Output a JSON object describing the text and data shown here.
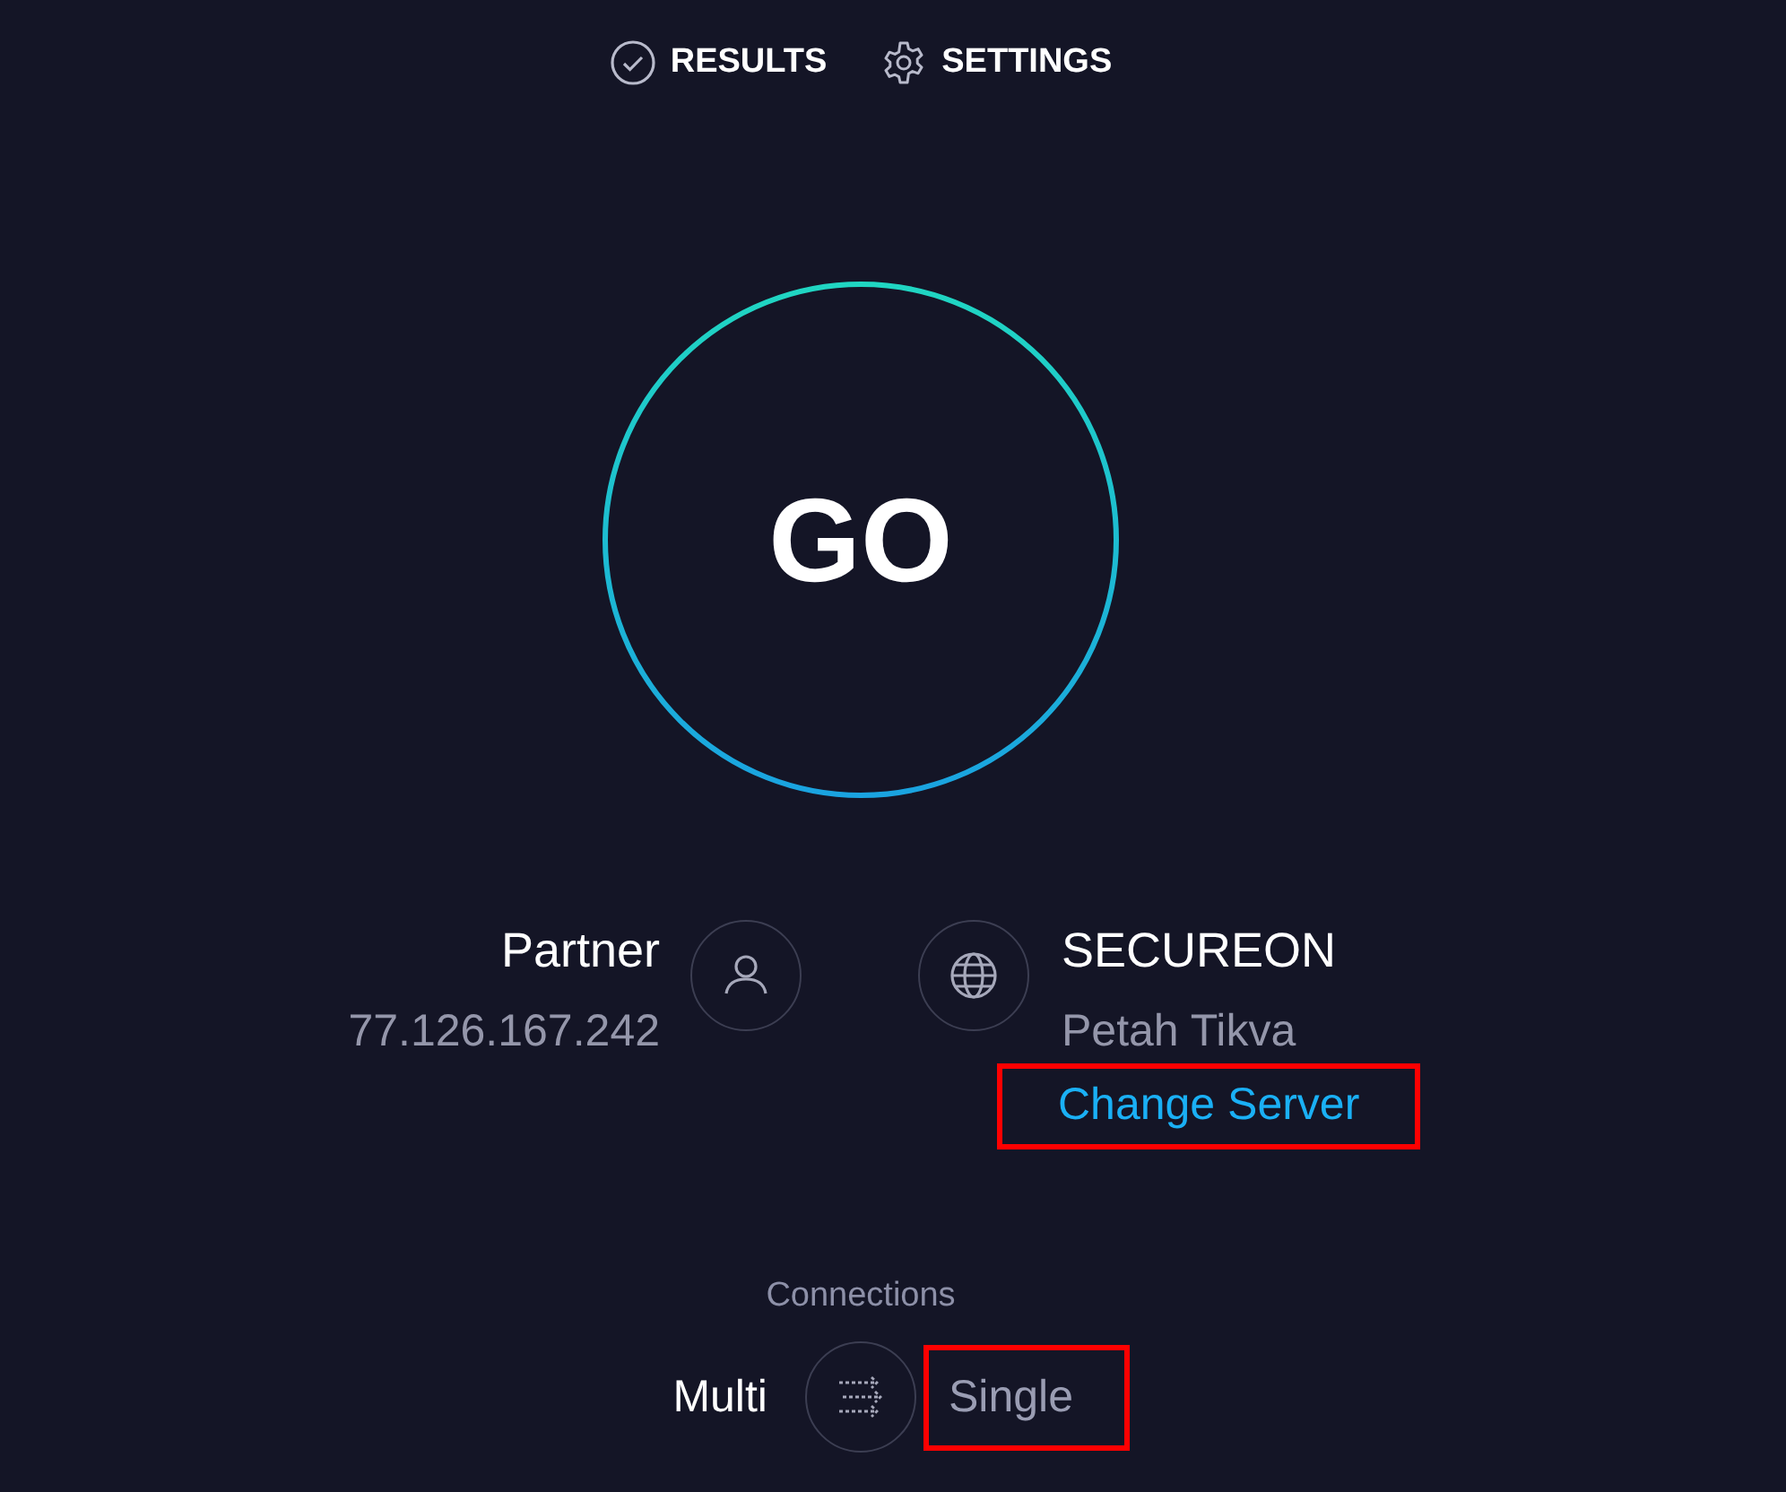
{
  "nav": [
    {
      "label": "RESULTS"
    },
    {
      "label": "SETTINGS"
    }
  ],
  "go_button": {
    "label": "GO"
  },
  "isp": {
    "name": "Partner",
    "ip": "77.126.167.242"
  },
  "server": {
    "name": "SECUREON",
    "location": "Petah Tikva",
    "link": "Change Server",
    "link_highlighted": true
  },
  "connections": {
    "label": "Connections",
    "options": [
      {
        "label": "Multi",
        "selected": true,
        "highlighted": false
      },
      {
        "label": "Single",
        "selected": false,
        "highlighted": true
      }
    ]
  }
}
